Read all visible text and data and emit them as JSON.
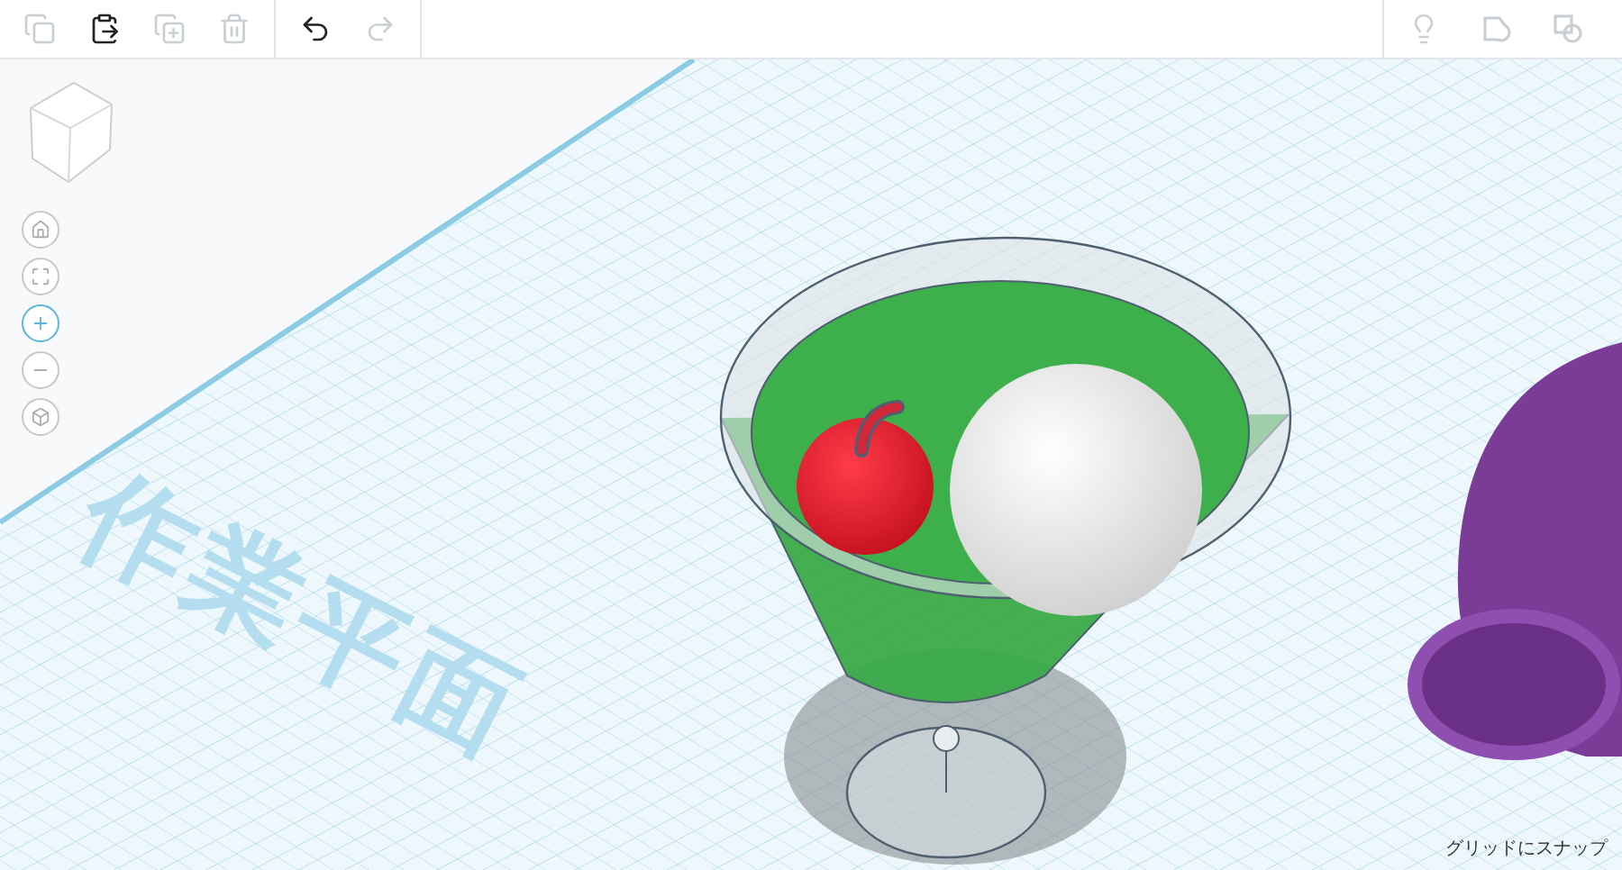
{
  "toolbar": {
    "edit_buttons": [
      {
        "kind": "copy",
        "disabled": true
      },
      {
        "kind": "paste",
        "disabled": false
      },
      {
        "kind": "duplicate",
        "disabled": true
      },
      {
        "kind": "delete",
        "disabled": true
      }
    ],
    "history_buttons": [
      {
        "kind": "undo",
        "disabled": false
      },
      {
        "kind": "redo",
        "disabled": true
      }
    ],
    "right_buttons": [
      {
        "kind": "hint",
        "disabled": true
      },
      {
        "kind": "group",
        "disabled": true
      },
      {
        "kind": "ungroup",
        "disabled": true
      }
    ]
  },
  "view_controls": [
    {
      "kind": "home",
      "active": false
    },
    {
      "kind": "fit",
      "active": false
    },
    {
      "kind": "zoom_in",
      "active": true
    },
    {
      "kind": "zoom_out",
      "active": false
    },
    {
      "kind": "perspective",
      "active": false
    }
  ],
  "workplane": {
    "label": "作業平面"
  },
  "snap_label": "グリッドにスナップ"
}
